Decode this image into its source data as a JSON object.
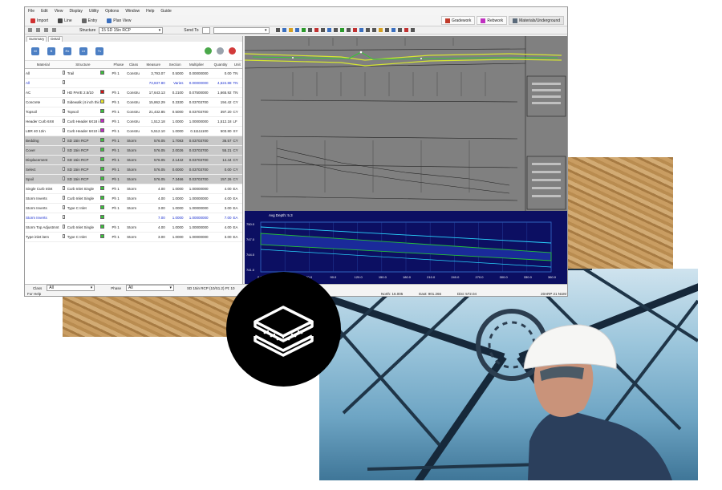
{
  "menu": [
    "File",
    "Edit",
    "View",
    "Display",
    "Utility",
    "Options",
    "Window",
    "Help",
    "Guide"
  ],
  "toolbar": {
    "import": "Import",
    "line": "Line",
    "entry": "Entry",
    "plan_view": "Plan View"
  },
  "right_tabs": [
    "Gradework",
    "Rebwork",
    "Materials/Underground"
  ],
  "structure_label": "Structure",
  "structure_value": "15 SD 15in RCP",
  "send_to_label": "Send To",
  "subtabs": [
    "Summary",
    "Detail"
  ],
  "big_icons": [
    "M",
    "B",
    "Rx",
    "Ur",
    "Tv"
  ],
  "columns": [
    "Material",
    "",
    "Structure",
    "",
    "Phase",
    "Class",
    "Measure",
    "Section",
    "Multiplier",
    "Quantity",
    "Unit"
  ],
  "rows": [
    {
      "material": "All",
      "structure": "Trail",
      "swatch": "#3bbf3b",
      "phase": "Ph 1",
      "cls": "Constru",
      "measure": "3,793.07",
      "section": "0.5000",
      "mult": "0.00000000",
      "qty": "0.00",
      "unit": "TN",
      "style": ""
    },
    {
      "material": "All",
      "structure": "",
      "swatch": "",
      "phase": "",
      "cls": "",
      "measure": "73,837.80",
      "section": "Varies",
      "mult": "0.00000000",
      "qty": "4,624.88",
      "unit": "TN",
      "style": "blue"
    },
    {
      "material": "AC",
      "structure": "HD PAVE 2.5/10",
      "swatch": "#d01515",
      "phase": "Ph 1",
      "cls": "Constru",
      "measure": "17,643.13",
      "section": "0.2100",
      "mult": "0.07500000",
      "qty": "1,665.92",
      "unit": "TN",
      "style": ""
    },
    {
      "material": "Concrete",
      "structure": "Sidewalk (4 inch thick)",
      "swatch": "#e8e52a",
      "phase": "Ph 1",
      "cls": "Constru",
      "measure": "15,862.29",
      "section": "0.3330",
      "mult": "0.03703700",
      "qty": "194.42",
      "unit": "CY",
      "style": ""
    },
    {
      "material": "Topsoil",
      "structure": "Topsoil",
      "swatch": "#3bbf3b",
      "phase": "Ph 1",
      "cls": "Constru",
      "measure": "21,432.85",
      "section": "0.5000",
      "mult": "0.03703700",
      "qty": "397.20",
      "unit": "CY",
      "style": ""
    },
    {
      "material": "Header Curb 6X8",
      "structure": "Curb Header 6X18 in",
      "swatch": "#c02ac0",
      "phase": "Ph 1",
      "cls": "Constru",
      "measure": "1,512.18",
      "section": "1.0000",
      "mult": "1.00000000",
      "qty": "1,512.18",
      "unit": "LF",
      "style": ""
    },
    {
      "material": "LBR 40 12in",
      "structure": "Curb Header 6X10 in",
      "swatch": "#c02ac0",
      "phase": "Ph 1",
      "cls": "Constru",
      "measure": "5,512.10",
      "section": "1.0000",
      "mult": "0.11111100",
      "qty": "503.80",
      "unit": "SY",
      "style": ""
    },
    {
      "material": "Bedding",
      "structure": "SD 15in RCP",
      "swatch": "#3bbf3b",
      "phase": "Ph 1",
      "cls": "Storm",
      "measure": "576.05",
      "section": "1.7083",
      "mult": "0.03703700",
      "qty": "36.57",
      "unit": "CY",
      "style": "grey"
    },
    {
      "material": "Cover",
      "structure": "SD 15in RCP",
      "swatch": "#3bbf3b",
      "phase": "Ph 1",
      "cls": "Storm",
      "measure": "576.05",
      "section": "2.0026",
      "mult": "0.03703700",
      "qty": "55.21",
      "unit": "CY",
      "style": "grey"
    },
    {
      "material": "Displacement",
      "structure": "SD 15in RCP",
      "swatch": "#3bbf3b",
      "phase": "Ph 1",
      "cls": "Storm",
      "measure": "576.05",
      "section": "2.1442",
      "mult": "0.03703700",
      "qty": "14.44",
      "unit": "CY",
      "style": "grey"
    },
    {
      "material": "Select",
      "structure": "SD 15in RCP",
      "swatch": "#3bbf3b",
      "phase": "Ph 1",
      "cls": "Storm",
      "measure": "576.05",
      "section": "0.0000",
      "mult": "0.03703700",
      "qty": "0.00",
      "unit": "CY",
      "style": "grey"
    },
    {
      "material": "Spoil",
      "structure": "SD 15in RCP",
      "swatch": "#3bbf3b",
      "phase": "Ph 1",
      "cls": "Storm",
      "measure": "576.05",
      "section": "7.3466",
      "mult": "0.03703700",
      "qty": "157.26",
      "unit": "CY",
      "style": "grey"
    },
    {
      "material": "Single Curb Inlet",
      "structure": "Curb Inlet Single",
      "swatch": "#3bbf3b",
      "phase": "Ph 1",
      "cls": "Storm",
      "measure": "4.00",
      "section": "1.0000",
      "mult": "1.00000000",
      "qty": "4.00",
      "unit": "EA",
      "style": ""
    },
    {
      "material": "Storm Inverts",
      "structure": "Curb Inlet Single",
      "swatch": "#3bbf3b",
      "phase": "Ph 1",
      "cls": "Storm",
      "measure": "4.00",
      "section": "1.0000",
      "mult": "1.00000000",
      "qty": "4.00",
      "unit": "EA",
      "style": ""
    },
    {
      "material": "Storm Inverts",
      "structure": "Type C Inlet",
      "swatch": "#3bbf3b",
      "phase": "Ph 1",
      "cls": "Storm",
      "measure": "3.00",
      "section": "1.0000",
      "mult": "1.00000000",
      "qty": "3.00",
      "unit": "EA",
      "style": ""
    },
    {
      "material": "Storm Inverts",
      "structure": "",
      "swatch": "#3bbf3b",
      "phase": "",
      "cls": "",
      "measure": "7.00",
      "section": "1.0000",
      "mult": "1.00000000",
      "qty": "7.00",
      "unit": "EA",
      "style": "blue"
    },
    {
      "material": "Storm Top Adjustmnt",
      "structure": "Curb Inlet Single",
      "swatch": "#3bbf3b",
      "phase": "Ph 1",
      "cls": "Storm",
      "measure": "4.00",
      "section": "1.0000",
      "mult": "1.00000000",
      "qty": "4.00",
      "unit": "EA",
      "style": ""
    },
    {
      "material": "Type inlet item",
      "structure": "Type C Inlet",
      "swatch": "#3bbf3b",
      "phase": "Ph 1",
      "cls": "Storm",
      "measure": "3.00",
      "section": "1.0000",
      "mult": "1.00000000",
      "qty": "3.00",
      "unit": "EA",
      "style": ""
    }
  ],
  "status": {
    "class_label": "Class",
    "class_value": "All",
    "phase_label": "Phase",
    "phase_value": "All",
    "structure_info": "SD 15in RCP (10/S1.2) Pt: 10",
    "rim_label": "Rim Invert",
    "rim_value": "746.50-744.10",
    "north": "North: 16.005",
    "east": "East: 901.266",
    "dist": "Dist: 572.04",
    "help": "For Help",
    "mode": "20ARP 21 NUM"
  },
  "profile": {
    "title": "Avg Depth: 5.3",
    "y_ticks": [
      "750.0",
      "747.0",
      "744.0",
      "741.0"
    ],
    "x_ticks": [
      "0.0",
      "30.0",
      "60.0",
      "90.0",
      "120.0",
      "150.0",
      "180.0",
      "210.0",
      "240.0",
      "270.0",
      "300.0",
      "330.0",
      "360.0"
    ]
  }
}
